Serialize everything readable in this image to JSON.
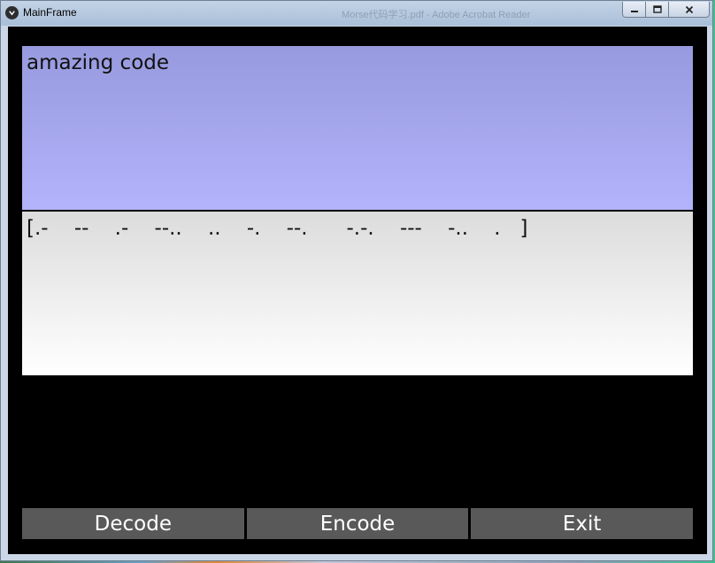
{
  "window": {
    "title": "MainFrame",
    "background_tab_text": "Morse代码学习.pdf - Adobe Acrobat Reader"
  },
  "titlebar_controls": {
    "minimize_icon": "minimize-icon",
    "maximize_icon": "maximize-icon",
    "close_icon": "close-icon"
  },
  "input": {
    "value": "amazing code"
  },
  "output": {
    "value": "[.-    --    .-    --..    ..    -.    --.      -.-.    ---    -..    .   ]"
  },
  "buttons": {
    "decode": "Decode",
    "encode": "Encode",
    "exit": "Exit"
  },
  "colors": {
    "input_panel_top": "#979ade",
    "input_panel_bottom": "#b3b3fb",
    "output_panel_top": "#dcdcdc",
    "output_panel_bottom": "#ffffff",
    "button_bg": "#595959",
    "client_bg": "#000000"
  }
}
